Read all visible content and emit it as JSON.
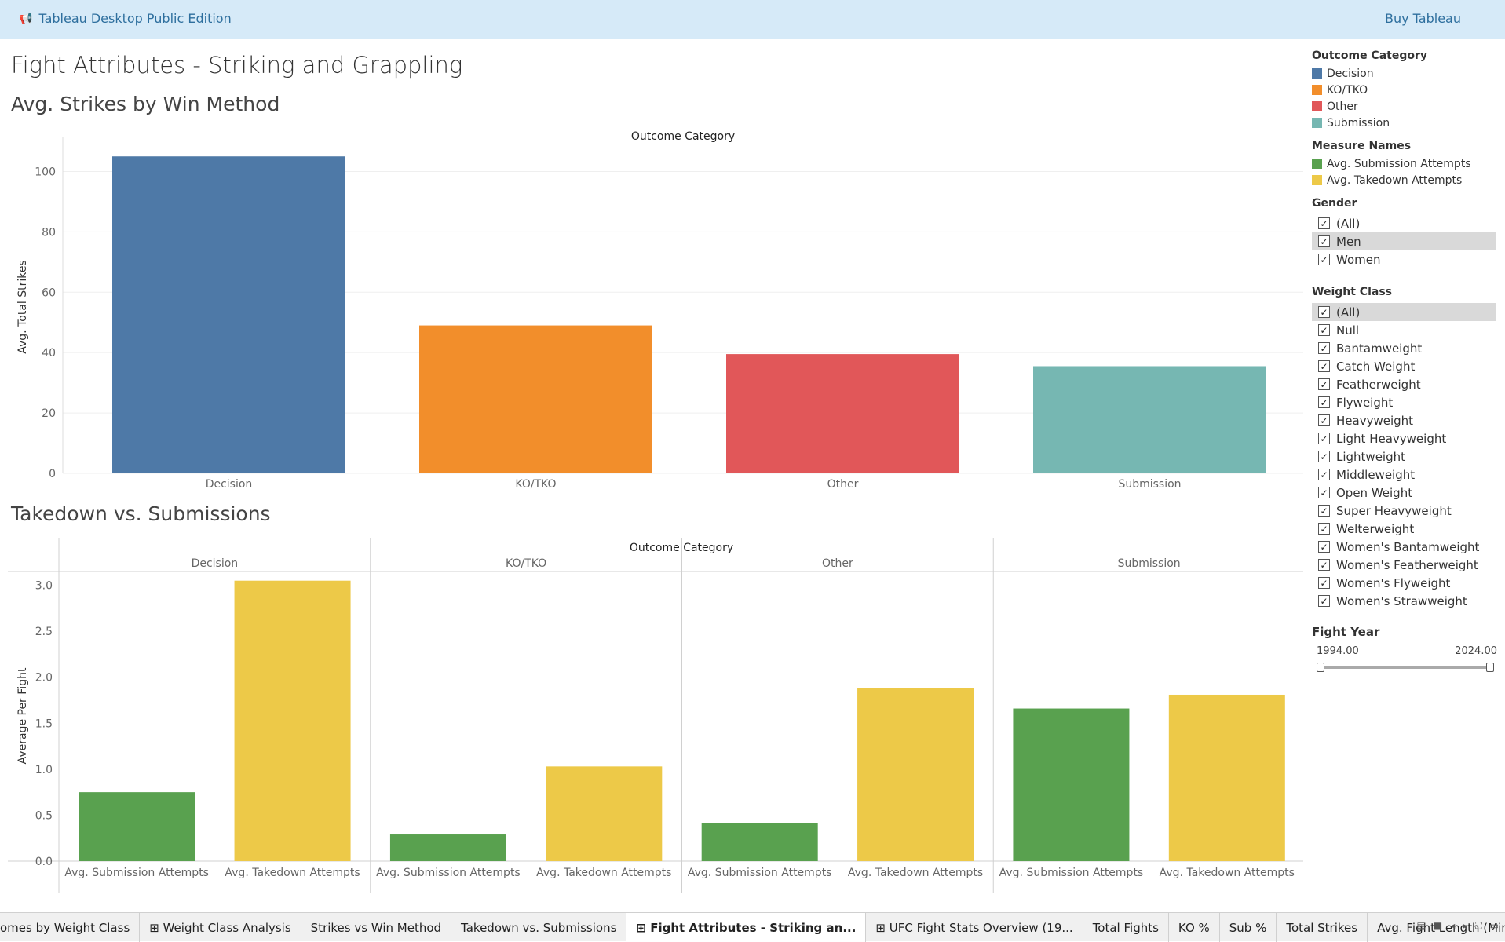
{
  "topbar": {
    "brand": "Tableau Desktop Public Edition",
    "buy": "Buy Tableau"
  },
  "dashboard": {
    "title": "Fight Attributes - Striking and Grappling",
    "sub1": "Avg. Strikes by Win Method",
    "sub2": "Takedown vs. Submissions"
  },
  "legend": {
    "outcome_title": "Outcome Category",
    "outcome_items": [
      {
        "label": "Decision",
        "color": "#4e79a7"
      },
      {
        "label": "KO/TKO",
        "color": "#f28e2b"
      },
      {
        "label": "Other",
        "color": "#e15759"
      },
      {
        "label": "Submission",
        "color": "#76b7b2"
      }
    ],
    "measure_title": "Measure Names",
    "measure_items": [
      {
        "label": "Avg. Submission Attempts",
        "color": "#59a14f"
      },
      {
        "label": "Avg. Takedown Attempts",
        "color": "#edc948"
      }
    ]
  },
  "gender": {
    "title": "Gender",
    "options": [
      "(All)",
      "Men",
      "Women"
    ],
    "selected": "Men"
  },
  "weight_class": {
    "title": "Weight Class",
    "options": [
      "(All)",
      "Null",
      "Bantamweight",
      "Catch Weight",
      "Featherweight",
      "Flyweight",
      "Heavyweight",
      "Light Heavyweight",
      "Lightweight",
      "Middleweight",
      "Open Weight",
      "Super Heavyweight",
      "Welterweight",
      "Women's Bantamweight",
      "Women's Featherweight",
      "Women's Flyweight",
      "Women's Strawweight"
    ],
    "selected": "(All)"
  },
  "fight_year": {
    "title": "Fight Year",
    "min": "1994.00",
    "max": "2024.00"
  },
  "tabs": [
    {
      "label": "omes by Weight Class",
      "icon": ""
    },
    {
      "label": "Weight Class Analysis",
      "icon": "⊞"
    },
    {
      "label": "Strikes vs Win Method",
      "icon": ""
    },
    {
      "label": "Takedown vs. Submissions",
      "icon": ""
    },
    {
      "label": "Fight Attributes - Striking an...",
      "icon": "⊞"
    },
    {
      "label": "UFC Fight Stats Overview (19...",
      "icon": "⊞"
    },
    {
      "label": "Total Fights",
      "icon": ""
    },
    {
      "label": "KO %",
      "icon": ""
    },
    {
      "label": "Sub %",
      "icon": ""
    },
    {
      "label": "Total Strikes",
      "icon": ""
    },
    {
      "label": "Avg. Fight Length (Minutes)",
      "icon": ""
    }
  ],
  "active_tab": 4,
  "chart_data": [
    {
      "type": "bar",
      "header": "Outcome Category",
      "ylabel": "Avg. Total Strikes",
      "categories": [
        "Decision",
        "KO/TKO",
        "Other",
        "Submission"
      ],
      "values": [
        105,
        49,
        39.5,
        35.5
      ],
      "colors": [
        "#4e79a7",
        "#f28e2b",
        "#e15759",
        "#76b7b2"
      ],
      "ylim": [
        0,
        110
      ],
      "yticks": [
        0,
        20,
        40,
        60,
        80,
        100
      ]
    },
    {
      "type": "bar",
      "header": "Outcome Category",
      "ylabel": "Average Per Fight",
      "panels": [
        "Decision",
        "KO/TKO",
        "Other",
        "Submission"
      ],
      "measures": [
        "Avg. Submission Attempts",
        "Avg. Takedown Attempts"
      ],
      "colors": [
        "#59a14f",
        "#edc948"
      ],
      "series": [
        {
          "name": "Avg. Submission Attempts",
          "values": [
            0.75,
            0.29,
            0.41,
            1.66
          ]
        },
        {
          "name": "Avg. Takedown Attempts",
          "values": [
            3.05,
            1.03,
            1.88,
            1.81
          ]
        }
      ],
      "ylim": [
        0,
        3.15
      ],
      "yticks": [
        "0.0",
        "0.5",
        "1.0",
        "1.5",
        "2.0",
        "2.5",
        "3.0"
      ]
    }
  ]
}
